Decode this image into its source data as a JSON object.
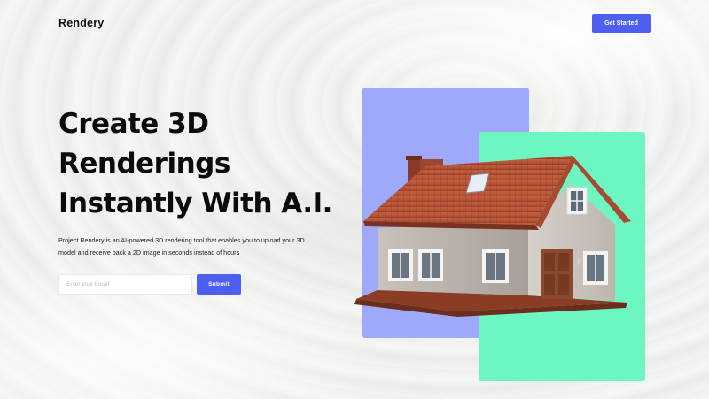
{
  "header": {
    "brand": "Rendery",
    "cta_label": "Get Started"
  },
  "hero": {
    "headline_lines": [
      "Create 3D",
      "Renderings",
      "Instantly With A.I."
    ],
    "description_lines": [
      "Project Rendery is an AI-powered 3D rendering tool that enables you to upload your 3D",
      "model and receive back a 2D image in seconds instead of hours"
    ],
    "email_placeholder": "Enter your Email",
    "submit_label": "Submit"
  },
  "illustration": {
    "name": "house",
    "colors": {
      "blue_card": "#9eaaf9",
      "green_card": "#6ef6c2",
      "roof": "#b8553a",
      "walls": "#b7afa8",
      "door": "#8a4a2e",
      "accent": "#4d5ff0"
    }
  }
}
